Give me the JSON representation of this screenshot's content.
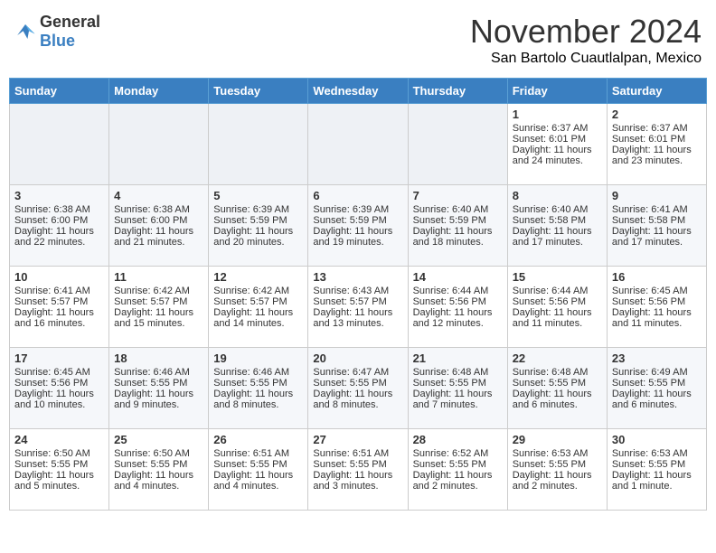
{
  "header": {
    "logo_general": "General",
    "logo_blue": "Blue",
    "month_title": "November 2024",
    "subtitle": "San Bartolo Cuautlalpan, Mexico"
  },
  "days_of_week": [
    "Sunday",
    "Monday",
    "Tuesday",
    "Wednesday",
    "Thursday",
    "Friday",
    "Saturday"
  ],
  "weeks": [
    [
      {
        "day": "",
        "lines": []
      },
      {
        "day": "",
        "lines": []
      },
      {
        "day": "",
        "lines": []
      },
      {
        "day": "",
        "lines": []
      },
      {
        "day": "",
        "lines": []
      },
      {
        "day": "1",
        "lines": [
          "Sunrise: 6:37 AM",
          "Sunset: 6:01 PM",
          "Daylight: 11 hours and 24 minutes."
        ]
      },
      {
        "day": "2",
        "lines": [
          "Sunrise: 6:37 AM",
          "Sunset: 6:01 PM",
          "Daylight: 11 hours and 23 minutes."
        ]
      }
    ],
    [
      {
        "day": "3",
        "lines": [
          "Sunrise: 6:38 AM",
          "Sunset: 6:00 PM",
          "Daylight: 11 hours and 22 minutes."
        ]
      },
      {
        "day": "4",
        "lines": [
          "Sunrise: 6:38 AM",
          "Sunset: 6:00 PM",
          "Daylight: 11 hours and 21 minutes."
        ]
      },
      {
        "day": "5",
        "lines": [
          "Sunrise: 6:39 AM",
          "Sunset: 5:59 PM",
          "Daylight: 11 hours and 20 minutes."
        ]
      },
      {
        "day": "6",
        "lines": [
          "Sunrise: 6:39 AM",
          "Sunset: 5:59 PM",
          "Daylight: 11 hours and 19 minutes."
        ]
      },
      {
        "day": "7",
        "lines": [
          "Sunrise: 6:40 AM",
          "Sunset: 5:59 PM",
          "Daylight: 11 hours and 18 minutes."
        ]
      },
      {
        "day": "8",
        "lines": [
          "Sunrise: 6:40 AM",
          "Sunset: 5:58 PM",
          "Daylight: 11 hours and 17 minutes."
        ]
      },
      {
        "day": "9",
        "lines": [
          "Sunrise: 6:41 AM",
          "Sunset: 5:58 PM",
          "Daylight: 11 hours and 17 minutes."
        ]
      }
    ],
    [
      {
        "day": "10",
        "lines": [
          "Sunrise: 6:41 AM",
          "Sunset: 5:57 PM",
          "Daylight: 11 hours and 16 minutes."
        ]
      },
      {
        "day": "11",
        "lines": [
          "Sunrise: 6:42 AM",
          "Sunset: 5:57 PM",
          "Daylight: 11 hours and 15 minutes."
        ]
      },
      {
        "day": "12",
        "lines": [
          "Sunrise: 6:42 AM",
          "Sunset: 5:57 PM",
          "Daylight: 11 hours and 14 minutes."
        ]
      },
      {
        "day": "13",
        "lines": [
          "Sunrise: 6:43 AM",
          "Sunset: 5:57 PM",
          "Daylight: 11 hours and 13 minutes."
        ]
      },
      {
        "day": "14",
        "lines": [
          "Sunrise: 6:44 AM",
          "Sunset: 5:56 PM",
          "Daylight: 11 hours and 12 minutes."
        ]
      },
      {
        "day": "15",
        "lines": [
          "Sunrise: 6:44 AM",
          "Sunset: 5:56 PM",
          "Daylight: 11 hours and 11 minutes."
        ]
      },
      {
        "day": "16",
        "lines": [
          "Sunrise: 6:45 AM",
          "Sunset: 5:56 PM",
          "Daylight: 11 hours and 11 minutes."
        ]
      }
    ],
    [
      {
        "day": "17",
        "lines": [
          "Sunrise: 6:45 AM",
          "Sunset: 5:56 PM",
          "Daylight: 11 hours and 10 minutes."
        ]
      },
      {
        "day": "18",
        "lines": [
          "Sunrise: 6:46 AM",
          "Sunset: 5:55 PM",
          "Daylight: 11 hours and 9 minutes."
        ]
      },
      {
        "day": "19",
        "lines": [
          "Sunrise: 6:46 AM",
          "Sunset: 5:55 PM",
          "Daylight: 11 hours and 8 minutes."
        ]
      },
      {
        "day": "20",
        "lines": [
          "Sunrise: 6:47 AM",
          "Sunset: 5:55 PM",
          "Daylight: 11 hours and 8 minutes."
        ]
      },
      {
        "day": "21",
        "lines": [
          "Sunrise: 6:48 AM",
          "Sunset: 5:55 PM",
          "Daylight: 11 hours and 7 minutes."
        ]
      },
      {
        "day": "22",
        "lines": [
          "Sunrise: 6:48 AM",
          "Sunset: 5:55 PM",
          "Daylight: 11 hours and 6 minutes."
        ]
      },
      {
        "day": "23",
        "lines": [
          "Sunrise: 6:49 AM",
          "Sunset: 5:55 PM",
          "Daylight: 11 hours and 6 minutes."
        ]
      }
    ],
    [
      {
        "day": "24",
        "lines": [
          "Sunrise: 6:50 AM",
          "Sunset: 5:55 PM",
          "Daylight: 11 hours and 5 minutes."
        ]
      },
      {
        "day": "25",
        "lines": [
          "Sunrise: 6:50 AM",
          "Sunset: 5:55 PM",
          "Daylight: 11 hours and 4 minutes."
        ]
      },
      {
        "day": "26",
        "lines": [
          "Sunrise: 6:51 AM",
          "Sunset: 5:55 PM",
          "Daylight: 11 hours and 4 minutes."
        ]
      },
      {
        "day": "27",
        "lines": [
          "Sunrise: 6:51 AM",
          "Sunset: 5:55 PM",
          "Daylight: 11 hours and 3 minutes."
        ]
      },
      {
        "day": "28",
        "lines": [
          "Sunrise: 6:52 AM",
          "Sunset: 5:55 PM",
          "Daylight: 11 hours and 2 minutes."
        ]
      },
      {
        "day": "29",
        "lines": [
          "Sunrise: 6:53 AM",
          "Sunset: 5:55 PM",
          "Daylight: 11 hours and 2 minutes."
        ]
      },
      {
        "day": "30",
        "lines": [
          "Sunrise: 6:53 AM",
          "Sunset: 5:55 PM",
          "Daylight: 11 hours and 1 minute."
        ]
      }
    ]
  ]
}
